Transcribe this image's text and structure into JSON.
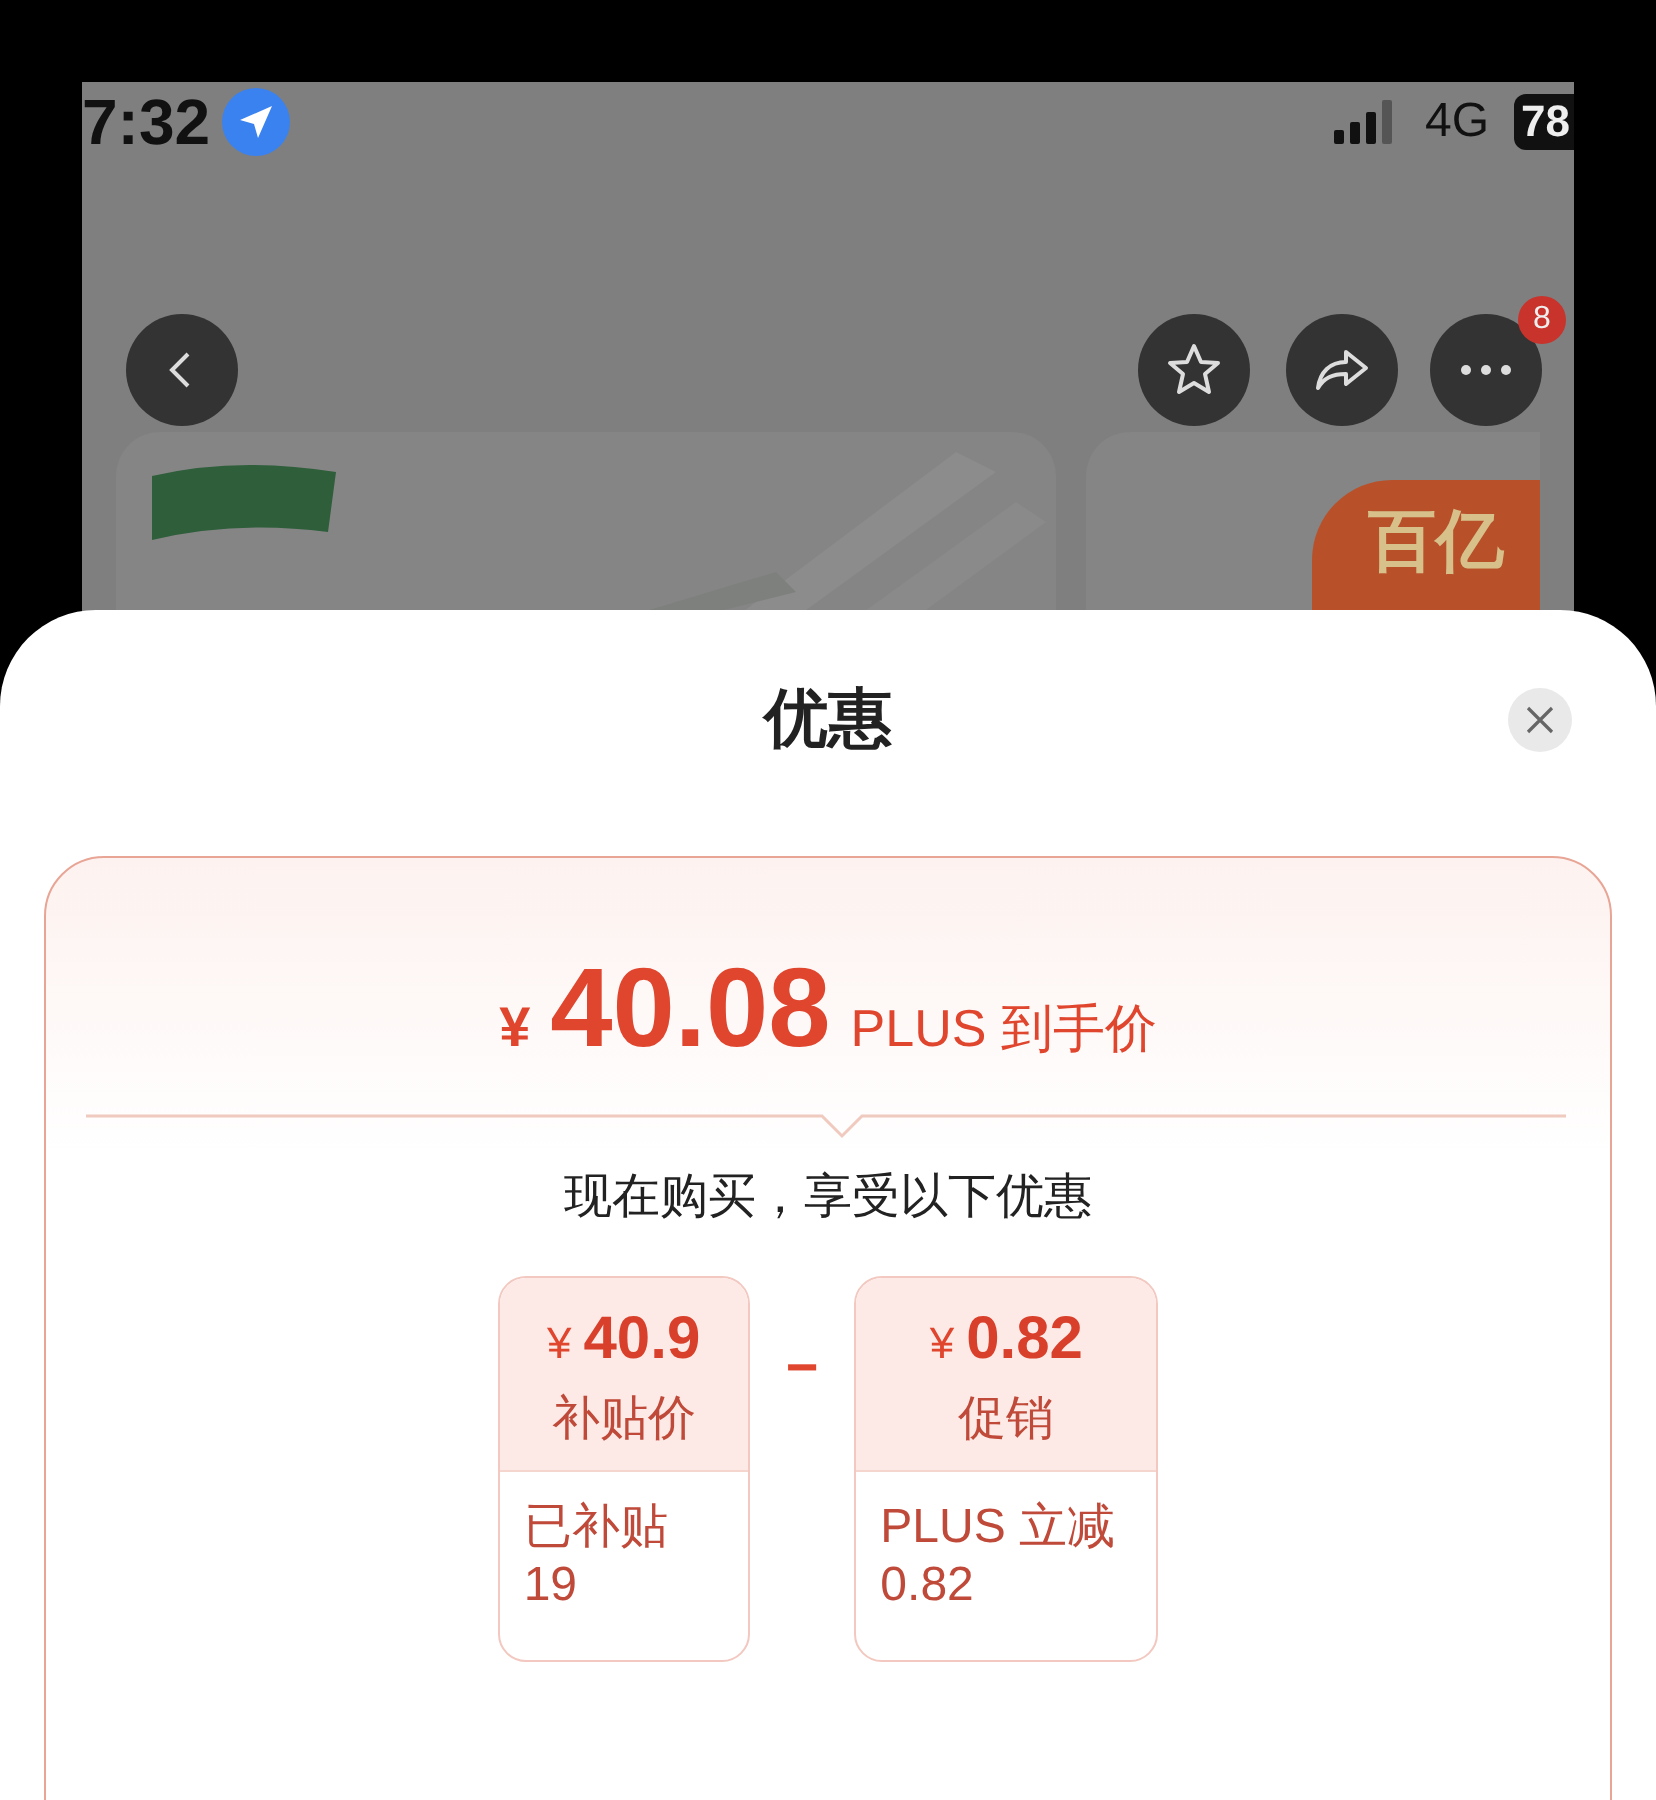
{
  "status_bar": {
    "time": "7:32",
    "network": "4G",
    "battery": "78"
  },
  "nav": {
    "more_badge": "8"
  },
  "product": {
    "badge": "百亿"
  },
  "sheet": {
    "title": "优惠",
    "price": {
      "currency": "¥",
      "amount": "40.08",
      "label": "PLUS 到手价"
    },
    "subtitle": "现在购买，享受以下优惠",
    "operator": "−",
    "items": [
      {
        "currency": "¥",
        "amount": "40.9",
        "label": "补贴价",
        "note_lines": [
          "已补贴",
          "19"
        ]
      },
      {
        "currency": "¥",
        "amount": "0.82",
        "label": "促销",
        "note_lines": [
          "PLUS 立减",
          "0.82"
        ]
      }
    ]
  }
}
